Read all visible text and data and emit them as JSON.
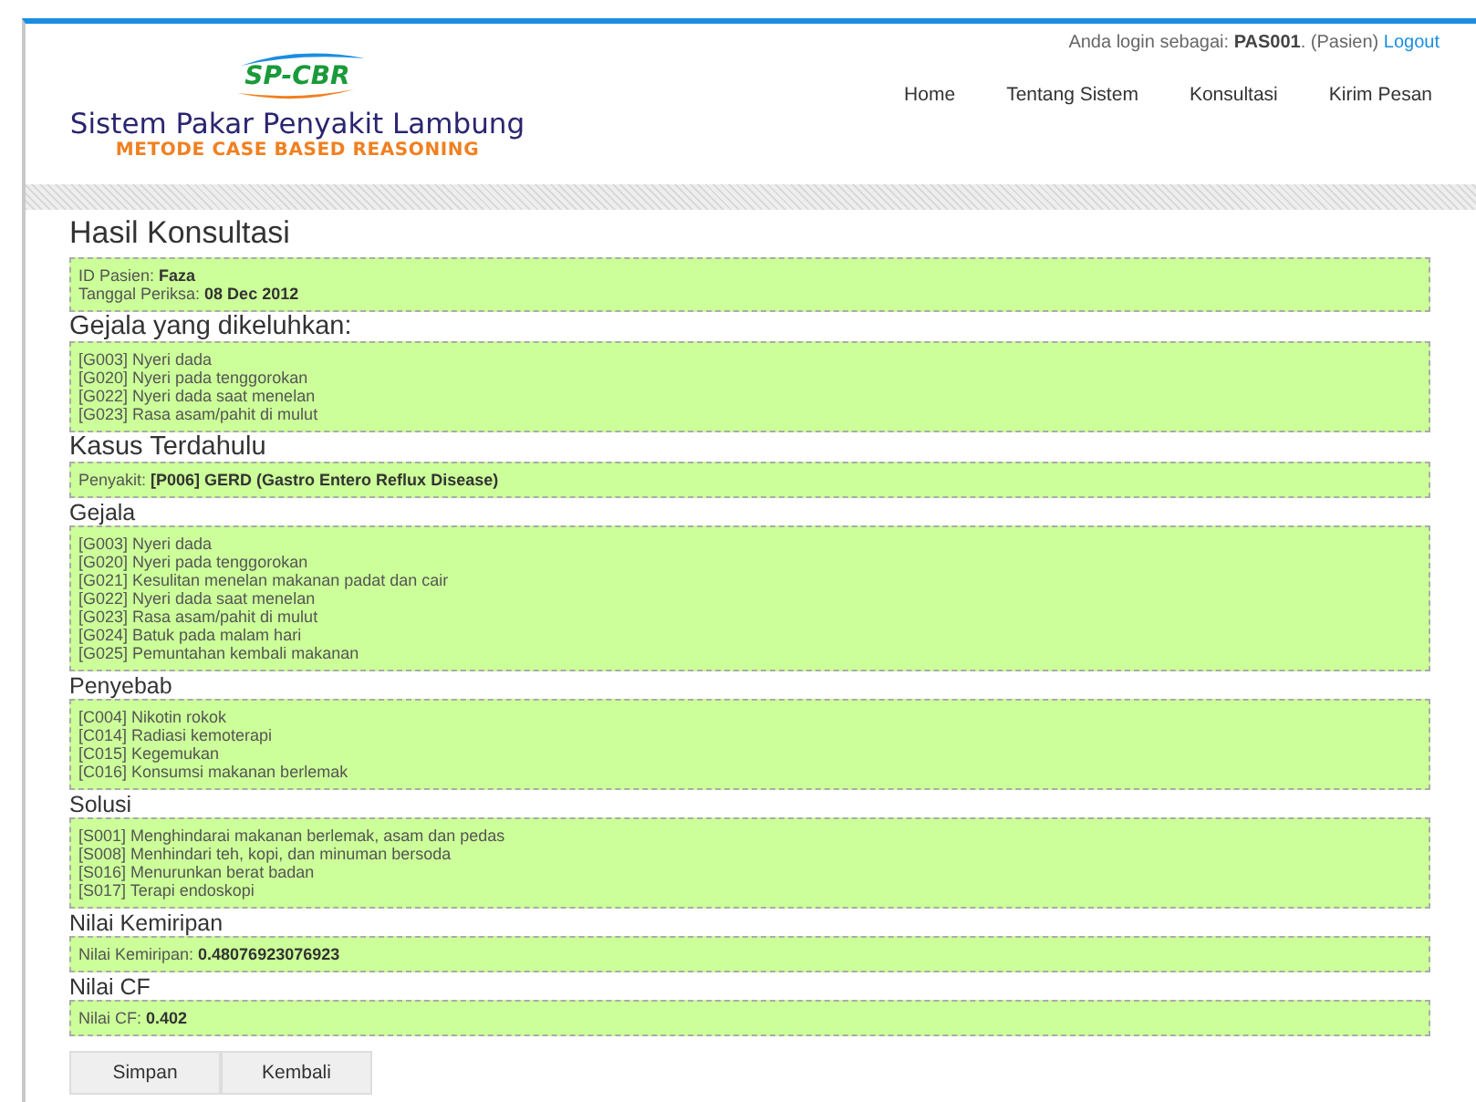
{
  "login": {
    "prefix": "Anda login sebagai: ",
    "user": "PAS001",
    "role": ". (Pasien) ",
    "logout": "Logout"
  },
  "logo": {
    "mark": "SP-CBR",
    "title": "Sistem Pakar Penyakit Lambung",
    "subtitle": "METODE CASE BASED REASONING"
  },
  "nav": [
    {
      "label": "Home"
    },
    {
      "label": "Tentang Sistem"
    },
    {
      "label": "Konsultasi"
    },
    {
      "label": "Kirim Pesan"
    }
  ],
  "page_title": "Hasil Konsultasi",
  "sections": [
    {
      "kind": "none",
      "lines": [
        "ID Pasien: **Faza**",
        "Tanggal Periksa: **08 Dec 2012**"
      ]
    },
    {
      "kind": "major",
      "heading": "Gejala yang dikeluhkan:",
      "lines": [
        "[G003] Nyeri dada",
        "[G020] Nyeri pada tenggorokan",
        "[G022] Nyeri dada saat menelan",
        "[G023] Rasa asam/pahit di mulut"
      ]
    },
    {
      "kind": "major",
      "heading": "Kasus Terdahulu",
      "lines": [
        "Penyakit: **[P006] GERD (Gastro Entero Reflux Disease)**"
      ]
    },
    {
      "kind": "minor",
      "heading": "Gejala",
      "lines": [
        "[G003] Nyeri dada",
        "[G020] Nyeri pada tenggorokan",
        "[G021] Kesulitan menelan makanan padat dan cair",
        "[G022] Nyeri dada saat menelan",
        "[G023] Rasa asam/pahit di mulut",
        "[G024] Batuk pada malam hari",
        "[G025] Pemuntahan kembali makanan"
      ]
    },
    {
      "kind": "minor",
      "heading": "Penyebab",
      "lines": [
        "[C004] Nikotin rokok",
        "[C014] Radiasi kemoterapi",
        "[C015] Kegemukan",
        "[C016] Konsumsi makanan berlemak"
      ]
    },
    {
      "kind": "minor",
      "heading": "Solusi",
      "lines": [
        "[S001] Menghindarai makanan berlemak, asam dan pedas",
        "[S008] Menhindari teh, kopi, dan minuman bersoda",
        "[S016] Menurunkan berat badan",
        "[S017] Terapi endoskopi"
      ]
    },
    {
      "kind": "minor",
      "heading": "Nilai Kemiripan",
      "lines": [
        "Nilai Kemiripan: **0.48076923076923**"
      ]
    },
    {
      "kind": "minor",
      "heading": "Nilai CF",
      "lines": [
        "Nilai CF: **0.402**"
      ]
    }
  ],
  "buttons": [
    "Simpan",
    "Kembali"
  ]
}
